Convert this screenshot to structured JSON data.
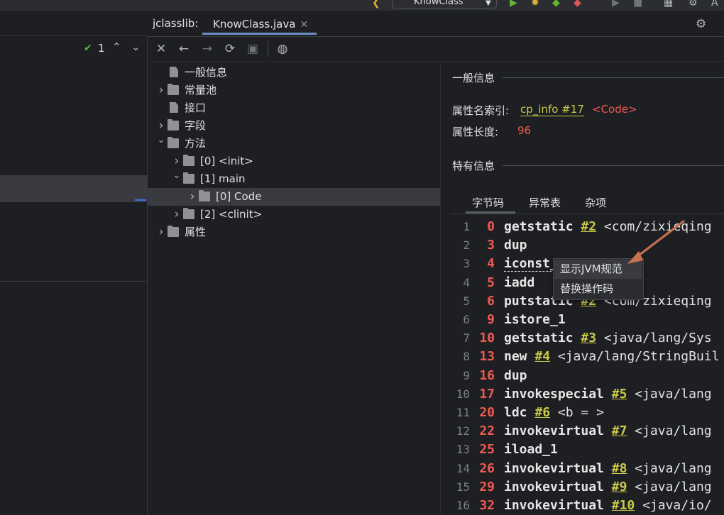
{
  "run_config": {
    "label": "KnowClass"
  },
  "left_editor": {
    "problems_count": "1"
  },
  "tool_window": {
    "title": "jclasslib:",
    "file_tab": "KnowClass.java"
  },
  "toolbar": {
    "buttons": [
      "close-icon",
      "back-icon",
      "forward-icon",
      "refresh-icon",
      "save-icon",
      "browser-icon"
    ]
  },
  "tree": {
    "items": [
      {
        "label": "一般信息",
        "type": "file",
        "depth": 0
      },
      {
        "label": "常量池",
        "type": "folder",
        "depth": 0,
        "expanded": false
      },
      {
        "label": "接口",
        "type": "file",
        "depth": 0
      },
      {
        "label": "字段",
        "type": "folder",
        "depth": 0,
        "expanded": false
      },
      {
        "label": "方法",
        "type": "folder",
        "depth": 0,
        "expanded": true
      },
      {
        "label": "[0] <init>",
        "type": "folder",
        "depth": 1,
        "expanded": false
      },
      {
        "label": "[1] main",
        "type": "folder",
        "depth": 1,
        "expanded": true
      },
      {
        "label": "[0] Code",
        "type": "folder",
        "depth": 2,
        "expanded": false,
        "selected": true
      },
      {
        "label": "[2] <clinit>",
        "type": "folder",
        "depth": 1,
        "expanded": false
      },
      {
        "label": "属性",
        "type": "folder",
        "depth": 0,
        "expanded": false
      }
    ]
  },
  "info": {
    "general_title": "一般信息",
    "name_index_key": "属性名索引:",
    "name_index_link": "cp_info #17",
    "name_index_value": "<Code>",
    "length_key": "属性长度:",
    "length_value": "96",
    "specific_title": "特有信息"
  },
  "tabs": [
    {
      "label": "字节码",
      "active": true
    },
    {
      "label": "异常表"
    },
    {
      "label": "杂项"
    }
  ],
  "bytecode": [
    {
      "line": "1",
      "offset": "0",
      "op": "getstatic",
      "ref": "#2",
      "rest": " <com/zixieqing"
    },
    {
      "line": "2",
      "offset": "3",
      "op": "dup",
      "ref": "",
      "rest": ""
    },
    {
      "line": "3",
      "offset": "4",
      "op": "iconst_1",
      "ref": "",
      "rest": ""
    },
    {
      "line": "4",
      "offset": "5",
      "op": "iadd",
      "ref": "",
      "rest": ""
    },
    {
      "line": "5",
      "offset": "6",
      "op": "putstatic",
      "ref": "#2",
      "rest": " <com/zixieqing"
    },
    {
      "line": "6",
      "offset": "9",
      "op": "istore_1",
      "ref": "",
      "rest": ""
    },
    {
      "line": "7",
      "offset": "10",
      "op": "getstatic",
      "ref": "#3",
      "rest": " <java/lang/Sys"
    },
    {
      "line": "8",
      "offset": "13",
      "op": "new",
      "ref": "#4",
      "rest": " <java/lang/StringBuil"
    },
    {
      "line": "9",
      "offset": "16",
      "op": "dup",
      "ref": "",
      "rest": ""
    },
    {
      "line": "10",
      "offset": "17",
      "op": "invokespecial",
      "ref": "#5",
      "rest": " <java/lang"
    },
    {
      "line": "11",
      "offset": "20",
      "op": "ldc",
      "ref": "#6",
      "rest": " <b = >"
    },
    {
      "line": "12",
      "offset": "22",
      "op": "invokevirtual",
      "ref": "#7",
      "rest": " <java/lang"
    },
    {
      "line": "13",
      "offset": "25",
      "op": "iload_1",
      "ref": "",
      "rest": ""
    },
    {
      "line": "14",
      "offset": "26",
      "op": "invokevirtual",
      "ref": "#8",
      "rest": " <java/lang"
    },
    {
      "line": "15",
      "offset": "29",
      "op": "invokevirtual",
      "ref": "#9",
      "rest": " <java/lang"
    },
    {
      "line": "16",
      "offset": "32",
      "op": "invokevirtual",
      "ref": "#10",
      "rest": " <java/io/"
    }
  ],
  "context_menu": {
    "items": [
      "显示JVM规范",
      "替换操作码"
    ],
    "highlighted": 0
  },
  "colors": {
    "offset": "#f05a52",
    "link": "#c9c94a",
    "selection": "#393b40",
    "arrow": "#c8734f"
  }
}
